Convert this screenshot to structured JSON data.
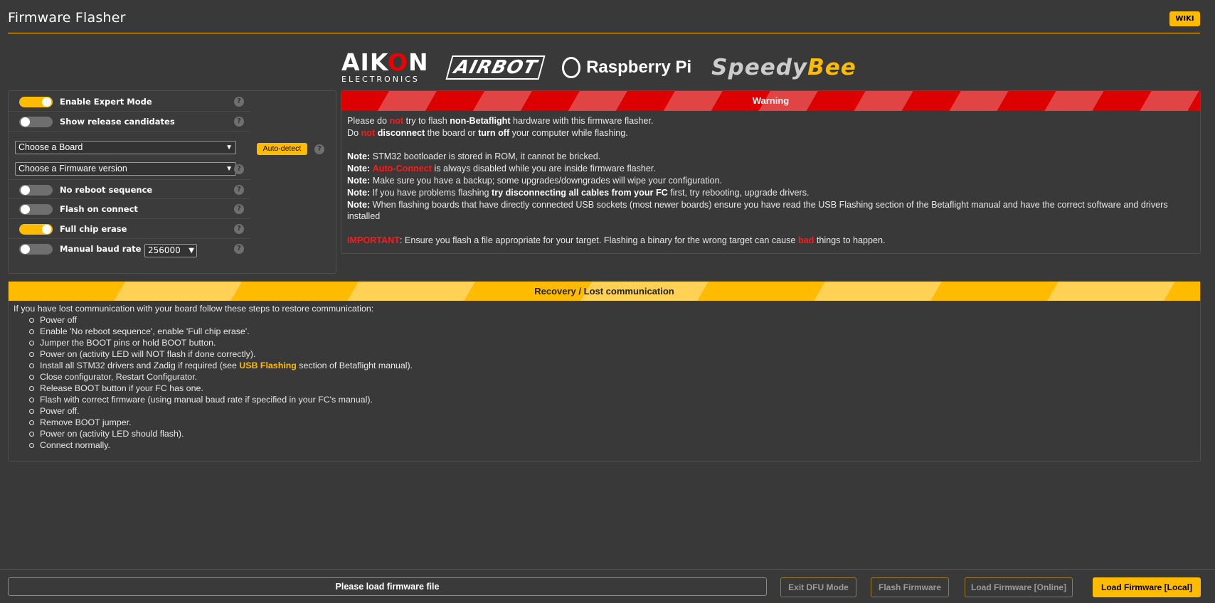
{
  "header": {
    "title": "Firmware Flasher",
    "wiki_label": "WIKI"
  },
  "logos": {
    "aikon_main_a": "AIK",
    "aikon_main_o": "O",
    "aikon_main_n": "N",
    "aikon_sub": "ELECTRONICS",
    "airbot": "AIRBOT",
    "rpi": "Raspberry Pi",
    "speedy": "Speedy",
    "bee": "Bee"
  },
  "options": {
    "expert_mode": {
      "label": "Enable Expert Mode",
      "on": true
    },
    "release_candidates": {
      "label": "Show release candidates",
      "on": false
    },
    "board_select": "Choose a Board",
    "auto_detect": "Auto-detect",
    "firmware_select": "Choose a Firmware version",
    "no_reboot": {
      "label": "No reboot sequence",
      "on": false
    },
    "flash_on_connect": {
      "label": "Flash on connect",
      "on": false
    },
    "full_chip_erase": {
      "label": "Full chip erase",
      "on": true
    },
    "manual_baud": {
      "label": "Manual baud rate",
      "on": false,
      "value": "256000"
    },
    "help_glyph": "?"
  },
  "warning": {
    "title": "Warning",
    "l1_a": "Please do ",
    "l1_not": "not",
    "l1_b": " try to flash ",
    "l1_c": "non-Betaflight",
    "l1_d": " hardware with this firmware flasher.",
    "l2_a": "Do ",
    "l2_not": "not",
    "l2_b": " disconnect",
    "l2_c": " the board or ",
    "l2_d": "turn off",
    "l2_e": " your computer while flashing.",
    "note_label": "Note:",
    "n1": " STM32 bootloader is stored in ROM, it cannot be bricked.",
    "n2_a": " ",
    "n2_red": "Auto-Connect",
    "n2_b": " is always disabled while you are inside firmware flasher.",
    "n3": " Make sure you have a backup; some upgrades/downgrades will wipe your configuration.",
    "n4_a": " If you have problems flashing ",
    "n4_b": "try disconnecting all cables from your FC",
    "n4_c": " first, try rebooting, upgrade drivers.",
    "n5": " When flashing boards that have directly connected USB sockets (most newer boards) ensure you have read the USB Flashing section of the Betaflight manual and have the correct software and drivers installed",
    "imp_label": "IMPORTANT",
    "imp_a": ": Ensure you flash a file appropriate for your target. Flashing a binary for the wrong target can cause ",
    "imp_bad": "bad",
    "imp_b": " things to happen."
  },
  "recovery": {
    "title": "Recovery / Lost communication",
    "intro": "If you have lost communication with your board follow these steps to restore communication:",
    "s1": "Power off",
    "s2": "Enable 'No reboot sequence', enable 'Full chip erase'.",
    "s3": "Jumper the BOOT pins or hold BOOT button.",
    "s4": "Power on (activity LED will NOT flash if done correctly).",
    "s5_a": "Install all STM32 drivers and Zadig if required (see ",
    "s5_link": "USB Flashing",
    "s5_b": " section of Betaflight manual).",
    "s6": "Close configurator, Restart Configurator.",
    "s7": "Release BOOT button if your FC has one.",
    "s8": "Flash with correct firmware (using manual baud rate if specified in your FC's manual).",
    "s9": "Power off.",
    "s10": "Remove BOOT jumper.",
    "s11": "Power on (activity LED should flash).",
    "s12": "Connect normally."
  },
  "footer": {
    "status": "Please load firmware file",
    "exit_dfu": "Exit DFU Mode",
    "flash": "Flash Firmware",
    "load_online": "Load Firmware [Online]",
    "load_local": "Load Firmware [Local]"
  },
  "colors": {
    "accent": "#ffbb00",
    "warning_red": "#dd0000",
    "background": "#393939"
  }
}
